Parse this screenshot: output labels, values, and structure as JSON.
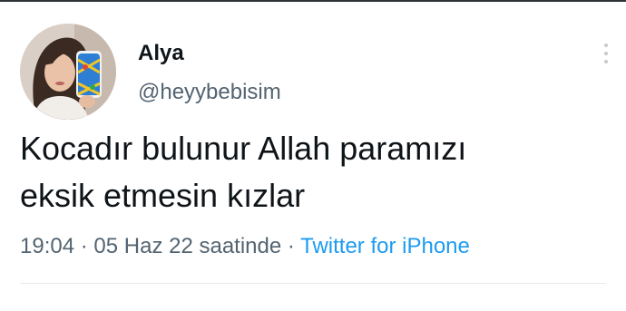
{
  "tweet": {
    "display_name": "Alya",
    "handle": "@heyybebisim",
    "text_lines": [
      "Kocadır bulunur Allah paramızı",
      "eksik etmesin kızlar"
    ],
    "time": "19:04",
    "separator": "·",
    "date_text": "05 Haz 22 saatinde",
    "source": "Twitter for iPhone",
    "avatar_icon": "profile-photo",
    "more_icon": "vertical-ellipsis-icon"
  },
  "colors": {
    "text_primary": "#0f1419",
    "text_secondary": "#536471",
    "link": "#1d9bf0",
    "divider": "#e7e9ea"
  }
}
